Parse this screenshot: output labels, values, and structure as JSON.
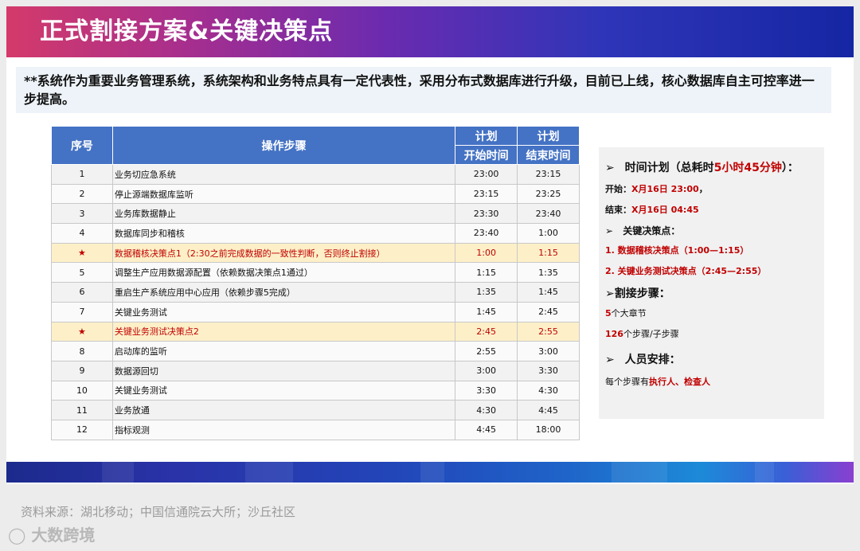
{
  "title": "正式割接方案&关键决策点",
  "intro": "**系统作为重要业务管理系统，系统架构和业务特点具有一定代表性，采用分布式数据库进行升级，目前已上线，核心数据库自主可控率进一步提高。",
  "table": {
    "col_no": "序号",
    "col_step": "操作步骤",
    "col_plan1": "计划",
    "col_plan2": "计划",
    "col_start": "开始时间",
    "col_end": "结束时间",
    "rows": [
      {
        "no": "1",
        "step": "业务切应急系统",
        "start": "23:00",
        "end": "23:15"
      },
      {
        "no": "2",
        "step": "停止源端数据库监听",
        "start": "23:15",
        "end": "23:25"
      },
      {
        "no": "3",
        "step": "业务库数据静止",
        "start": "23:30",
        "end": "23:40"
      },
      {
        "no": "4",
        "step": "数据库同步和稽核",
        "start": "23:40",
        "end": "1:00"
      },
      {
        "no": "★",
        "step": "数据稽核决策点1（2:30之前完成数据的一致性判断，否则终止割接）",
        "start": "1:00",
        "end": "1:15"
      },
      {
        "no": "5",
        "step": "调整生产应用数据源配置（依赖数据决策点1通过）",
        "start": "1:15",
        "end": "1:35"
      },
      {
        "no": "6",
        "step": "重启生产系统应用中心应用（依赖步骤5完成）",
        "start": "1:35",
        "end": "1:45"
      },
      {
        "no": "7",
        "step": "关键业务测试",
        "start": "1:45",
        "end": "2:45"
      },
      {
        "no": "★",
        "step": "关键业务测试决策点2",
        "start": "2:45",
        "end": "2:55"
      },
      {
        "no": "8",
        "step": "启动库的监听",
        "start": "2:55",
        "end": "3:00"
      },
      {
        "no": "9",
        "step": "数据源回切",
        "start": "3:00",
        "end": "3:30"
      },
      {
        "no": "10",
        "step": "关键业务测试",
        "start": "3:30",
        "end": "4:30"
      },
      {
        "no": "11",
        "step": "业务放通",
        "start": "4:30",
        "end": "4:45"
      },
      {
        "no": "12",
        "step": "指标观测",
        "start": "4:45",
        "end": "18:00"
      }
    ]
  },
  "panel": {
    "arrow": "➢",
    "time_heading": "时间计划（总耗时",
    "time_total": "5小时45分钟",
    "time_heading_end": "）：",
    "start_label": "开始：",
    "start_value": "X月16日 23:00",
    "start_tail": "，",
    "end_label": "结束：",
    "end_value": "X月16日 04:45",
    "decision_heading": "关键决策点：",
    "decision_1": "1.   数据稽核决策点（1:00—1:15）",
    "decision_2": "2.   关键业务测试决策点（2:45—2:55）",
    "cutover_heading": "割接步骤：",
    "chapters_num": "5",
    "chapters_text": "个大章节",
    "steps_num": "126",
    "steps_text": "个步骤/子步骤",
    "staff_heading": "人员安排：",
    "staff_text": "每个步骤有",
    "staff_roles": "执行人、检查人"
  },
  "footer": {
    "source": "资料来源：湖北移动；中国信通院云大所；沙丘社区",
    "logo": "大数跨境"
  },
  "colors": {
    "header_blue": "#4472c4",
    "highlight_row": "#fdf0c8",
    "accent_red": "#c00000"
  }
}
